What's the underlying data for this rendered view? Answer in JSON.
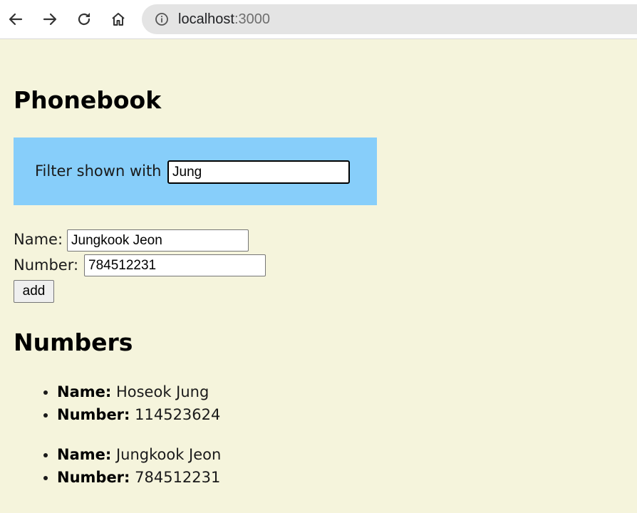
{
  "browser": {
    "url_host": "localhost",
    "url_port": ":3000"
  },
  "page": {
    "title": "Phonebook",
    "filter": {
      "label": "Filter shown with",
      "value": "Jung"
    },
    "form": {
      "name_label": "Name:",
      "name_value": "Jungkook Jeon",
      "number_label": "Number:",
      "number_value": "784512231",
      "add_label": "add"
    },
    "numbers_title": "Numbers",
    "entries": [
      {
        "name_label": "Name:",
        "name": "Hoseok Jung",
        "number_label": "Number:",
        "number": "114523624"
      },
      {
        "name_label": "Name:",
        "name": "Jungkook Jeon",
        "number_label": "Number:",
        "number": "784512231"
      }
    ]
  },
  "colors": {
    "page_background": "#f5f4dc",
    "filter_background": "#87cefa",
    "omnibox_background": "#e4e4e4"
  }
}
